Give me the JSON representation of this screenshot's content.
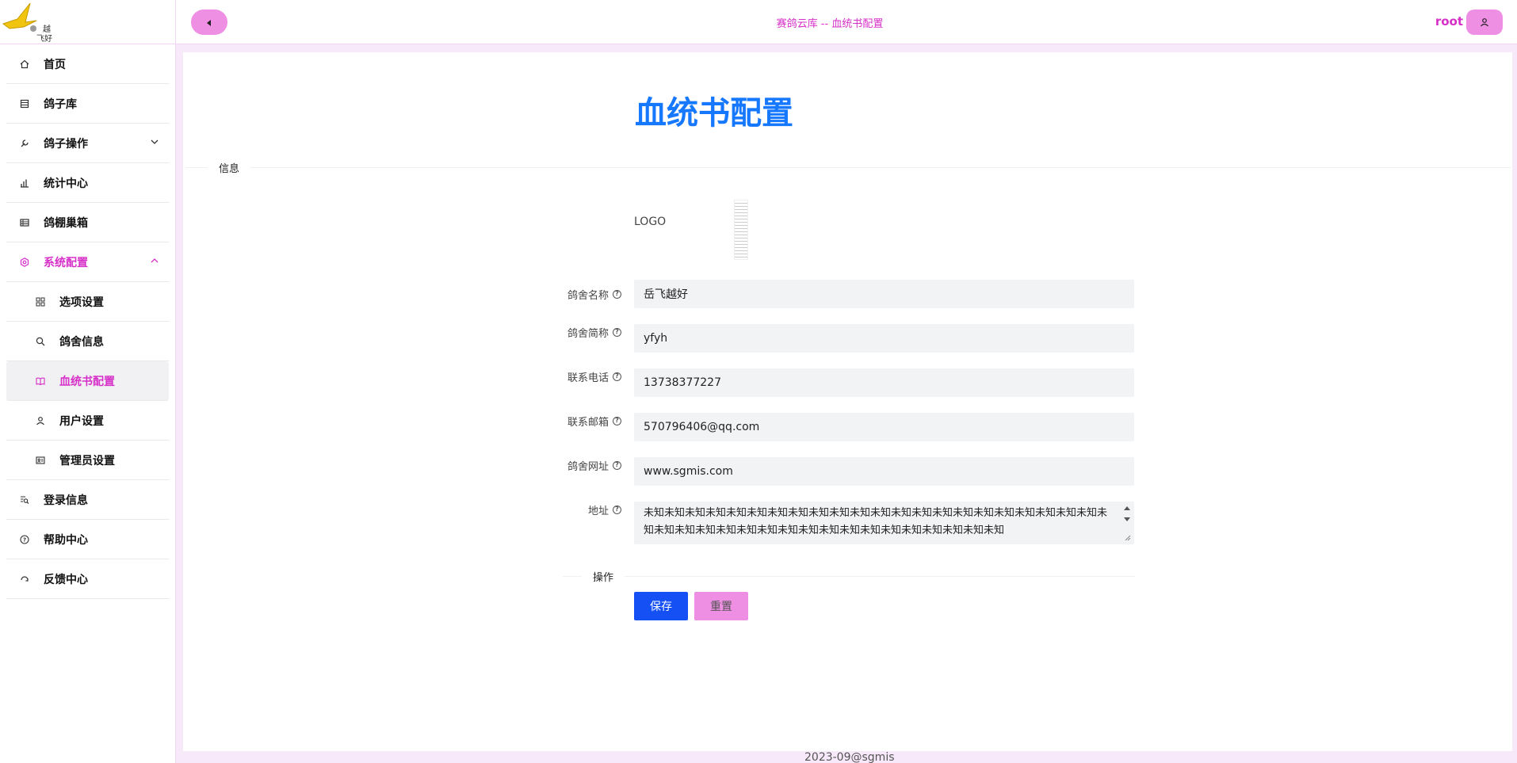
{
  "header": {
    "title": "赛鸽云库 -- 血统书配置",
    "user": "root"
  },
  "logo": {
    "text": "岳越飞好"
  },
  "sidebar": {
    "items": [
      {
        "label": "首页",
        "icon": "home-icon"
      },
      {
        "label": "鸽子库",
        "icon": "list-icon"
      },
      {
        "label": "鸽子操作",
        "icon": "wrench-icon"
      },
      {
        "label": "统计中心",
        "icon": "bar-chart-icon"
      },
      {
        "label": "鸽棚巢箱",
        "icon": "table-icon"
      },
      {
        "label": "系统配置",
        "icon": "gear-icon"
      },
      {
        "label": "选项设置",
        "icon": "grid-icon"
      },
      {
        "label": "鸽舍信息",
        "icon": "search-icon"
      },
      {
        "label": "血统书配置",
        "icon": "book-icon"
      },
      {
        "label": "用户设置",
        "icon": "user-icon"
      },
      {
        "label": "管理员设置",
        "icon": "id-card-icon"
      },
      {
        "label": "登录信息",
        "icon": "log-search-icon"
      },
      {
        "label": "帮助中心",
        "icon": "help-icon"
      },
      {
        "label": "反馈中心",
        "icon": "feedback-icon"
      }
    ]
  },
  "main": {
    "title": "血统书配置",
    "section_info": "信息",
    "logo_label": "LOGO",
    "fields": {
      "name": {
        "label": "鸽舍名称",
        "value": "岳飞越好"
      },
      "short": {
        "label": "鸽舍简称",
        "value": "yfyh"
      },
      "phone": {
        "label": "联系电话",
        "value": "13738377227"
      },
      "email": {
        "label": "联系邮箱",
        "value": "570796406@qq.com"
      },
      "site": {
        "label": "鸽舍网址",
        "value": "www.sgmis.com"
      },
      "address": {
        "label": "地址",
        "value": "未知未知未知未知未知未知未知未知未知未知未知未知未知未知未知未知未知未知未知未知未知未知未知未知未知未知未知未知未知未知未知未知未知未知未知未知未知未知未知未知"
      }
    },
    "section_actions": "操作",
    "save": "保存",
    "reset": "重置"
  },
  "footer": "2023-09@sgmis",
  "colors": {
    "accent": "#d630c8",
    "pink": "#ee8fe4",
    "blue": "#1677ff",
    "save": "#1550f5"
  }
}
